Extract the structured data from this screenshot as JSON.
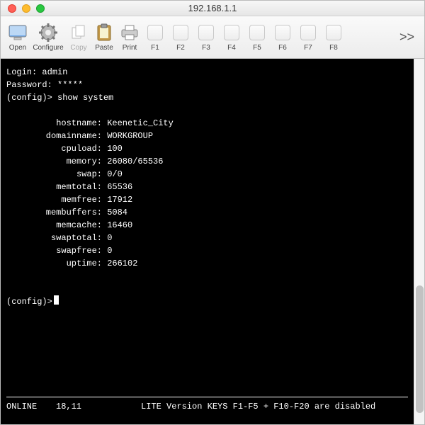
{
  "window": {
    "title": "192.168.1.1"
  },
  "toolbar": {
    "open": "Open",
    "configure": "Configure",
    "copy": "Copy",
    "paste": "Paste",
    "print": "Print",
    "f1": "F1",
    "f2": "F2",
    "f3": "F3",
    "f4": "F4",
    "f5": "F5",
    "f6": "F6",
    "f7": "F7",
    "f8": "F8",
    "overflow": ">>"
  },
  "terminal": {
    "login_label": "Login: ",
    "login_value": "admin",
    "password_label": "Password: ",
    "password_value": "*****",
    "prompt": "(config)>",
    "command": "show system",
    "fields": [
      {
        "key": "hostname",
        "value": "Keenetic_City"
      },
      {
        "key": "domainname",
        "value": "WORKGROUP"
      },
      {
        "key": "cpuload",
        "value": "100"
      },
      {
        "key": "memory",
        "value": "26080/65536"
      },
      {
        "key": "swap",
        "value": "0/0"
      },
      {
        "key": "memtotal",
        "value": "65536"
      },
      {
        "key": "memfree",
        "value": "17912"
      },
      {
        "key": "membuffers",
        "value": "5084"
      },
      {
        "key": "memcache",
        "value": "16460"
      },
      {
        "key": "swaptotal",
        "value": "0"
      },
      {
        "key": "swapfree",
        "value": "0"
      },
      {
        "key": "uptime",
        "value": "266102"
      }
    ]
  },
  "status": {
    "state": "ONLINE",
    "position": "18,11",
    "message": "LITE Version KEYS F1-F5 + F10-F20 are disabled"
  }
}
